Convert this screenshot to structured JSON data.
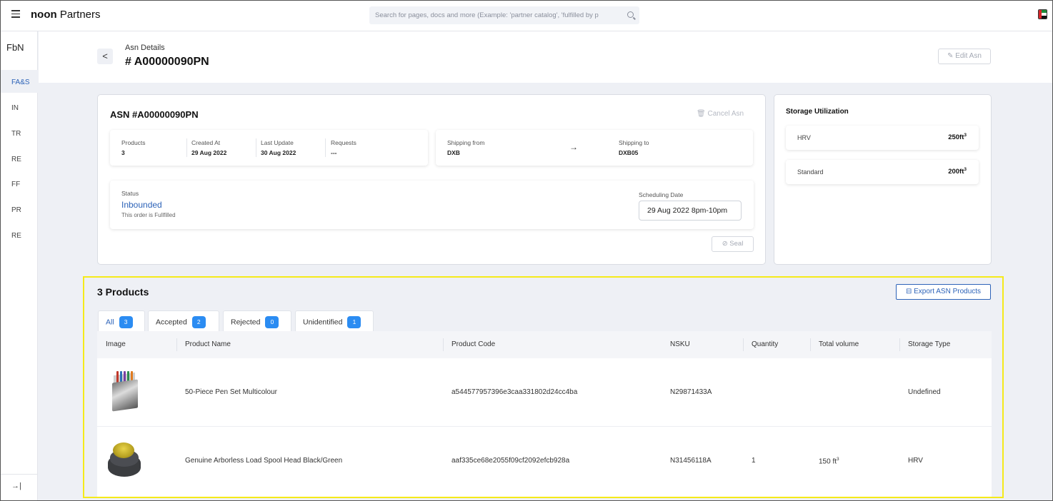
{
  "topbar": {
    "brand_bold": "noon",
    "brand_rest": " Partners",
    "search_placeholder": "Search for pages, docs and more (Example: 'partner catalog', 'fulfilled by p"
  },
  "sidebar": {
    "title": "FbN",
    "items": [
      {
        "label": "FA&S",
        "active": true
      },
      {
        "label": "IN"
      },
      {
        "label": "TR"
      },
      {
        "label": "RE"
      },
      {
        "label": "FF"
      },
      {
        "label": "PR"
      },
      {
        "label": "RE"
      }
    ],
    "collapse_label": "→|"
  },
  "header": {
    "back_label": "<",
    "subtitle": "Asn Details",
    "title": "# A00000090PN",
    "edit_label": "✎ Edit Asn"
  },
  "asn": {
    "heading": "ASN #A00000090PN",
    "cancel_label": "🗑 Cancel Asn",
    "products_label": "Products",
    "products_value": "3",
    "created_label": "Created At",
    "created_value": "29 Aug 2022",
    "updated_label": "Last Update",
    "updated_value": "30 Aug 2022",
    "requests_label": "Requests",
    "requests_value": "---",
    "from_label": "Shipping from",
    "from_value": "DXB",
    "arrow": "→",
    "to_label": "Shipping to",
    "to_value": "DXB05",
    "status_label": "Status",
    "status_value": "Inbounded",
    "status_note": "This order is Fullfilled",
    "sched_label": "Scheduling Date",
    "sched_value": "29 Aug 2022   8pm-10pm",
    "seal_label": "⊘ Seal"
  },
  "storage": {
    "title": "Storage Utilization",
    "rows": [
      {
        "name": "HRV",
        "value": "250ft",
        "unit_sup": "3"
      },
      {
        "name": "Standard",
        "value": "200ft",
        "unit_sup": "3"
      }
    ]
  },
  "products": {
    "title": "3 Products",
    "export_label": "⊟  Export ASN Products",
    "tabs": [
      {
        "label": "All",
        "count": "3",
        "active": true
      },
      {
        "label": "Accepted",
        "count": "2"
      },
      {
        "label": "Rejected",
        "count": "0"
      },
      {
        "label": "Unidentified",
        "count": "1"
      }
    ],
    "columns": [
      "Image",
      "Product Name",
      "Product Code",
      "NSKU",
      "Quantity",
      "Total volume",
      "Storage Type"
    ],
    "rows": [
      {
        "image": "pen-set-image",
        "name": "50-Piece Pen Set Multicolour",
        "code": "a544577957396e3caa331802d24cc4ba",
        "nsku": "N29871433A",
        "quantity": "",
        "volume": "",
        "volume_sup": "",
        "storage_type": "Undefined"
      },
      {
        "image": "spool-head-image",
        "name": "Genuine Arborless Load Spool Head Black/Green",
        "code": "aaf335ce68e2055f09cf2092efcb928a",
        "nsku": "N31456118A",
        "quantity": "1",
        "volume": "150 ft",
        "volume_sup": "3",
        "storage_type": "HRV"
      }
    ]
  },
  "colors": {
    "accent": "#2d63b8",
    "badge": "#2b8cf2",
    "highlight_border": "#f5ea1a",
    "page_bg": "#eef0f5"
  }
}
